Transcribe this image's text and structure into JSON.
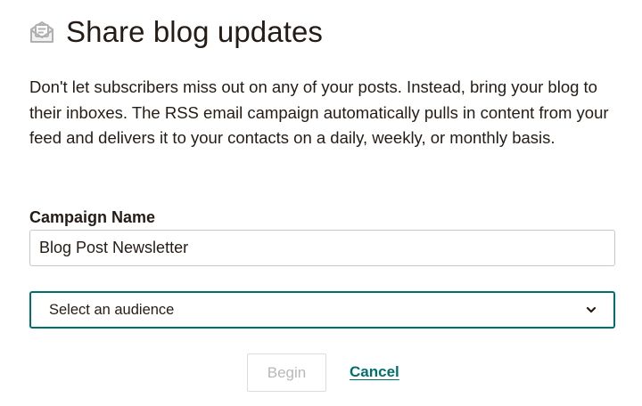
{
  "header": {
    "icon": "newsletter-envelope-icon",
    "title": "Share blog updates"
  },
  "description": "Don't let subscribers miss out on any of your posts. Instead, bring your blog to their inboxes. The RSS email campaign automatically pulls in content from your feed and delivers it to your contacts on a daily, weekly, or monthly basis.",
  "form": {
    "campaign_name_label": "Campaign Name",
    "campaign_name_value": "Blog Post Newsletter",
    "audience_select_value": "Select an audience",
    "audience_select_icon": "chevron-down-icon"
  },
  "actions": {
    "begin_label": "Begin",
    "cancel_label": "Cancel"
  },
  "colors": {
    "accent": "#00706f",
    "text": "#241c15",
    "icon": "#b0b0b0",
    "disabled_text": "#b8b8b8"
  }
}
